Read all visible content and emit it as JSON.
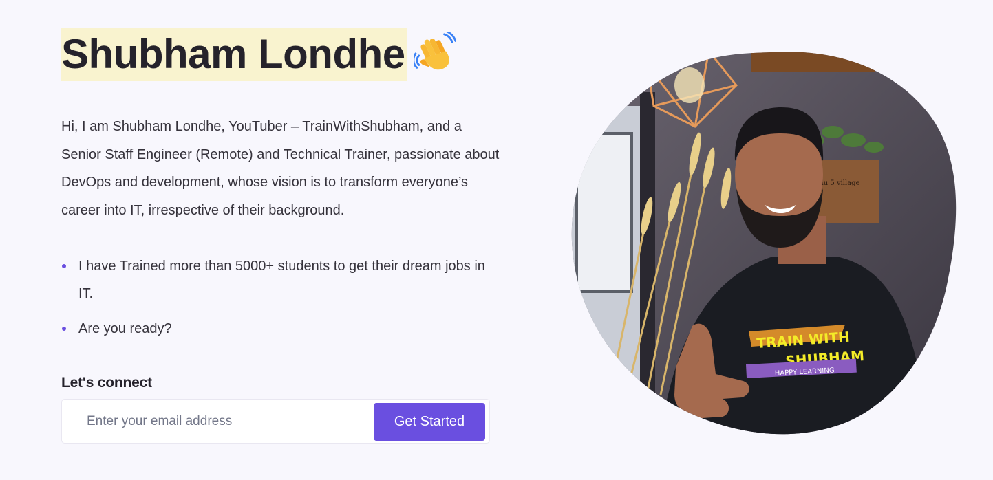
{
  "hero": {
    "name": "Shubham Londhe",
    "wave_icon": "waving-hand-emoji",
    "intro": "Hi, I am Shubham Londhe, YouTuber – TrainWithShubham, and a Senior Staff Engineer (Remote) and Technical Trainer, passionate about DevOps and development, whose vision is to transform everyone’s career into IT, irrespective of their background.",
    "bullets": [
      "I have Trained more than 5000+ students to get their dream jobs in IT.",
      "Are you ready?"
    ]
  },
  "connect": {
    "label": "Let's connect",
    "email_placeholder": "Enter your email address",
    "email_value": "",
    "button_label": "Get Started"
  },
  "portrait": {
    "alt": "Portrait photo",
    "shirt_text_line1": "TRAIN WITH",
    "shirt_text_line2": "SHUBHAM",
    "shirt_text_line3": "HAPPY LEARNING",
    "sign_text": "ti du 5 village"
  },
  "colors": {
    "accent": "#6a4fe0",
    "name_highlight": "#f9f3cf",
    "background": "#f8f7fd"
  }
}
